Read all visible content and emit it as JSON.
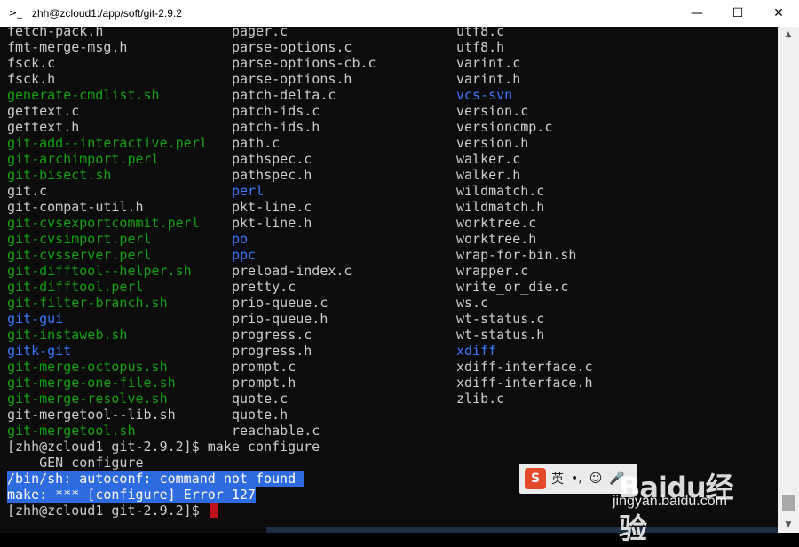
{
  "window": {
    "title": "zhh@zcloud1:/app/soft/git-2.9.2",
    "icon": "terminal-icon"
  },
  "controls": {
    "minimize": "—",
    "maximize": "☐",
    "close": "✕"
  },
  "colors": {
    "white": "#cccccc",
    "green": "#13a10e",
    "blue": "#3b78ff",
    "selection": "#2f6be0",
    "cursor": "#c0101c"
  },
  "listing": [
    [
      {
        "t": "fetch-pack.h",
        "c": "white"
      },
      {
        "t": "pager.c",
        "c": "white"
      },
      {
        "t": "utf8.c",
        "c": "white"
      }
    ],
    [
      {
        "t": "fmt-merge-msg.h",
        "c": "white"
      },
      {
        "t": "parse-options.c",
        "c": "white"
      },
      {
        "t": "utf8.h",
        "c": "white"
      }
    ],
    [
      {
        "t": "fsck.c",
        "c": "white"
      },
      {
        "t": "parse-options-cb.c",
        "c": "white"
      },
      {
        "t": "varint.c",
        "c": "white"
      }
    ],
    [
      {
        "t": "fsck.h",
        "c": "white"
      },
      {
        "t": "parse-options.h",
        "c": "white"
      },
      {
        "t": "varint.h",
        "c": "white"
      }
    ],
    [
      {
        "t": "generate-cmdlist.sh",
        "c": "green"
      },
      {
        "t": "patch-delta.c",
        "c": "white"
      },
      {
        "t": "vcs-svn",
        "c": "blue"
      }
    ],
    [
      {
        "t": "gettext.c",
        "c": "white"
      },
      {
        "t": "patch-ids.c",
        "c": "white"
      },
      {
        "t": "version.c",
        "c": "white"
      }
    ],
    [
      {
        "t": "gettext.h",
        "c": "white"
      },
      {
        "t": "patch-ids.h",
        "c": "white"
      },
      {
        "t": "versioncmp.c",
        "c": "white"
      }
    ],
    [
      {
        "t": "git-add--interactive.perl",
        "c": "green"
      },
      {
        "t": "path.c",
        "c": "white"
      },
      {
        "t": "version.h",
        "c": "white"
      }
    ],
    [
      {
        "t": "git-archimport.perl",
        "c": "green"
      },
      {
        "t": "pathspec.c",
        "c": "white"
      },
      {
        "t": "walker.c",
        "c": "white"
      }
    ],
    [
      {
        "t": "git-bisect.sh",
        "c": "green"
      },
      {
        "t": "pathspec.h",
        "c": "white"
      },
      {
        "t": "walker.h",
        "c": "white"
      }
    ],
    [
      {
        "t": "git.c",
        "c": "white"
      },
      {
        "t": "perl",
        "c": "blue"
      },
      {
        "t": "wildmatch.c",
        "c": "white"
      }
    ],
    [
      {
        "t": "git-compat-util.h",
        "c": "white"
      },
      {
        "t": "pkt-line.c",
        "c": "white"
      },
      {
        "t": "wildmatch.h",
        "c": "white"
      }
    ],
    [
      {
        "t": "git-cvsexportcommit.perl",
        "c": "green"
      },
      {
        "t": "pkt-line.h",
        "c": "white"
      },
      {
        "t": "worktree.c",
        "c": "white"
      }
    ],
    [
      {
        "t": "git-cvsimport.perl",
        "c": "green"
      },
      {
        "t": "po",
        "c": "blue"
      },
      {
        "t": "worktree.h",
        "c": "white"
      }
    ],
    [
      {
        "t": "git-cvsserver.perl",
        "c": "green"
      },
      {
        "t": "ppc",
        "c": "blue"
      },
      {
        "t": "wrap-for-bin.sh",
        "c": "white"
      }
    ],
    [
      {
        "t": "git-difftool--helper.sh",
        "c": "green"
      },
      {
        "t": "preload-index.c",
        "c": "white"
      },
      {
        "t": "wrapper.c",
        "c": "white"
      }
    ],
    [
      {
        "t": "git-difftool.perl",
        "c": "green"
      },
      {
        "t": "pretty.c",
        "c": "white"
      },
      {
        "t": "write_or_die.c",
        "c": "white"
      }
    ],
    [
      {
        "t": "git-filter-branch.sh",
        "c": "green"
      },
      {
        "t": "prio-queue.c",
        "c": "white"
      },
      {
        "t": "ws.c",
        "c": "white"
      }
    ],
    [
      {
        "t": "git-gui",
        "c": "blue"
      },
      {
        "t": "prio-queue.h",
        "c": "white"
      },
      {
        "t": "wt-status.c",
        "c": "white"
      }
    ],
    [
      {
        "t": "git-instaweb.sh",
        "c": "green"
      },
      {
        "t": "progress.c",
        "c": "white"
      },
      {
        "t": "wt-status.h",
        "c": "white"
      }
    ],
    [
      {
        "t": "gitk-git",
        "c": "blue"
      },
      {
        "t": "progress.h",
        "c": "white"
      },
      {
        "t": "xdiff",
        "c": "blue"
      }
    ],
    [
      {
        "t": "git-merge-octopus.sh",
        "c": "green"
      },
      {
        "t": "prompt.c",
        "c": "white"
      },
      {
        "t": "xdiff-interface.c",
        "c": "white"
      }
    ],
    [
      {
        "t": "git-merge-one-file.sh",
        "c": "green"
      },
      {
        "t": "prompt.h",
        "c": "white"
      },
      {
        "t": "xdiff-interface.h",
        "c": "white"
      }
    ],
    [
      {
        "t": "git-merge-resolve.sh",
        "c": "green"
      },
      {
        "t": "quote.c",
        "c": "white"
      },
      {
        "t": "zlib.c",
        "c": "white"
      }
    ],
    [
      {
        "t": "git-mergetool--lib.sh",
        "c": "white"
      },
      {
        "t": "quote.h",
        "c": "white"
      },
      {
        "t": "",
        "c": "white"
      }
    ],
    [
      {
        "t": "git-mergetool.sh",
        "c": "green"
      },
      {
        "t": "reachable.c",
        "c": "white"
      },
      {
        "t": "",
        "c": "white"
      }
    ]
  ],
  "output": {
    "cmd_line": "[zhh@zcloud1 git-2.9.2]$ make configure",
    "gen_line": "    GEN configure",
    "error1": "/bin/sh: autoconf: command not found ",
    "error2": "make: *** [configure] Error 127",
    "prompt": "[zhh@zcloud1 git-2.9.2]$ "
  },
  "scrollbar": {
    "up": "▲",
    "down": "▼"
  },
  "watermark": {
    "ime_logo": "S",
    "ime_items": [
      "英",
      "•,",
      "☺",
      "🎤"
    ],
    "brand": "Baidu经验",
    "url": "jingyan.baidu.com"
  }
}
